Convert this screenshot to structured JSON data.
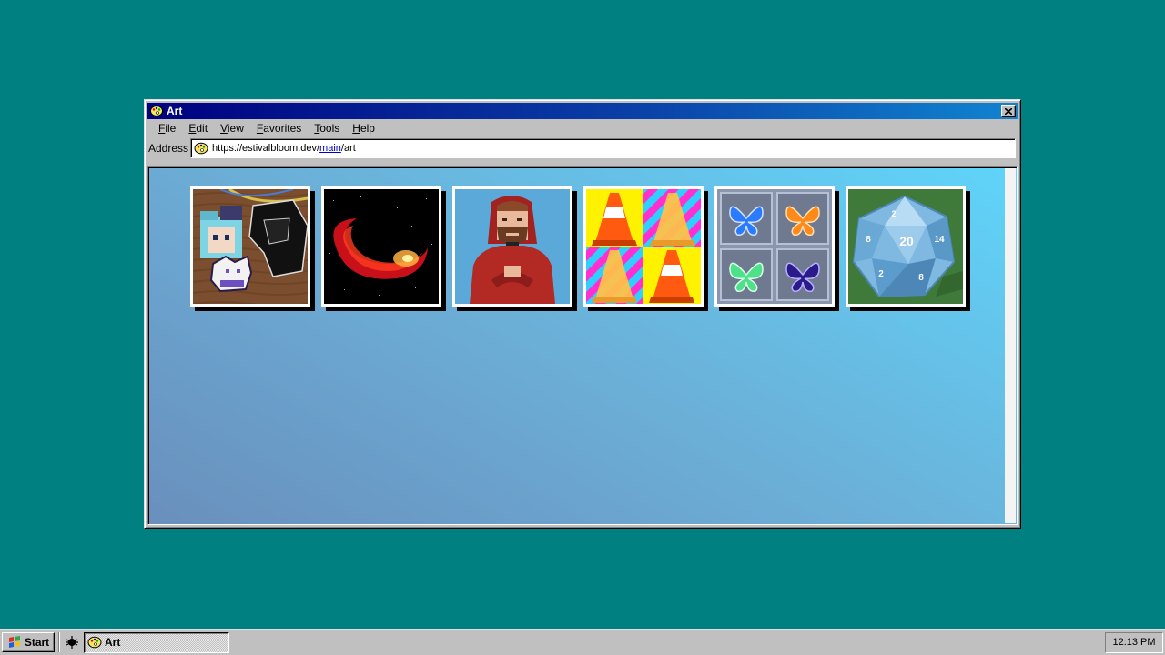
{
  "window": {
    "title": "Art",
    "close_icon": "close-icon"
  },
  "menu": [
    {
      "label": "File"
    },
    {
      "label": "Edit"
    },
    {
      "label": "View"
    },
    {
      "label": "Favorites"
    },
    {
      "label": "Tools"
    },
    {
      "label": "Help"
    }
  ],
  "address": {
    "label": "Address",
    "prefix": "https://estivalbloom.dev/",
    "link": "main",
    "suffix": "/art"
  },
  "gallery": [
    {
      "name": "perler-bead-characters-artwork"
    },
    {
      "name": "red-galaxy-swirl-artwork"
    },
    {
      "name": "red-hoodie-portrait-artwork"
    },
    {
      "name": "traffic-cones-pop-art-artwork"
    },
    {
      "name": "butterfly-grid-artwork"
    },
    {
      "name": "d20-dice-artwork"
    }
  ],
  "taskbar": {
    "start_label": "Start",
    "task_label": "Art",
    "clock": "12:13 PM"
  },
  "colors": {
    "desktop": "#008080",
    "titlebar_start": "#000080",
    "titlebar_end": "#1084d0"
  }
}
